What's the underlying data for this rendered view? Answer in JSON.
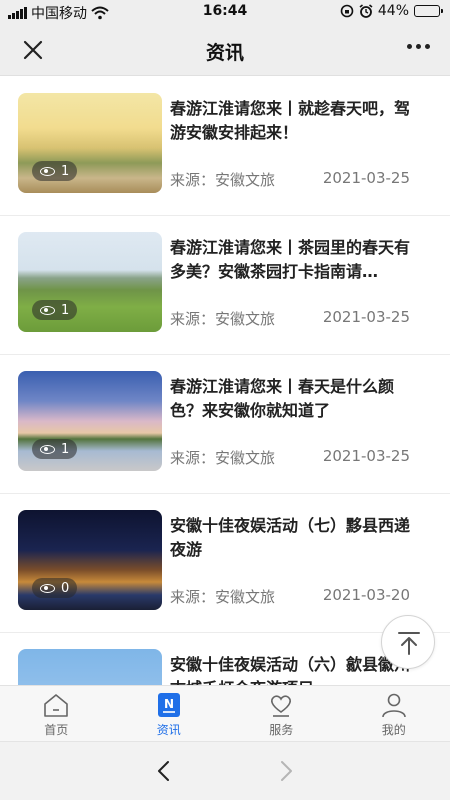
{
  "status_bar": {
    "carrier": "中国移动",
    "time": "16:44",
    "battery": "44%",
    "battery_level": 0.44,
    "icons": [
      "signal-icon",
      "wifi-icon",
      "rotation-lock-icon",
      "alarm-icon",
      "battery-icon"
    ]
  },
  "header": {
    "title": "资讯",
    "close_icon": "close-icon",
    "more_icon": "more-icon"
  },
  "articles": [
    {
      "title": "春游江淮请您来丨就趁春天吧，驾游安徽安排起来！",
      "views": "1",
      "source": "来源：安徽文旅",
      "date": "2021-03-25"
    },
    {
      "title": "春游江淮请您来丨茶园里的春天有多美？安徽茶园打卡指南请…",
      "views": "1",
      "source": "来源：安徽文旅",
      "date": "2021-03-25"
    },
    {
      "title": "春游江淮请您来丨春天是什么颜色？来安徽你就知道了",
      "views": "1",
      "source": "来源：安徽文旅",
      "date": "2021-03-25"
    },
    {
      "title": "安徽十佳夜娱活动（七）黟县西递夜游",
      "views": "0",
      "source": "来源：安徽文旅",
      "date": "2021-03-20"
    },
    {
      "title": "安徽十佳夜娱活动（六）歙县徽州古城千灯会夜游项目",
      "views": "",
      "source": "",
      "date": ""
    }
  ],
  "back_to_top_icon": "arrow-up-icon",
  "tab_bar": {
    "active": "资讯",
    "tabs": [
      {
        "label": "首页",
        "icon": "home-icon"
      },
      {
        "label": "资讯",
        "icon": "news-icon"
      },
      {
        "label": "服务",
        "icon": "heart-hand-icon"
      },
      {
        "label": "我的",
        "icon": "user-icon"
      }
    ]
  },
  "colors": {
    "accent": "#1f6fe8",
    "header_bg": "#eeeeee",
    "meta_text": "#777777"
  }
}
